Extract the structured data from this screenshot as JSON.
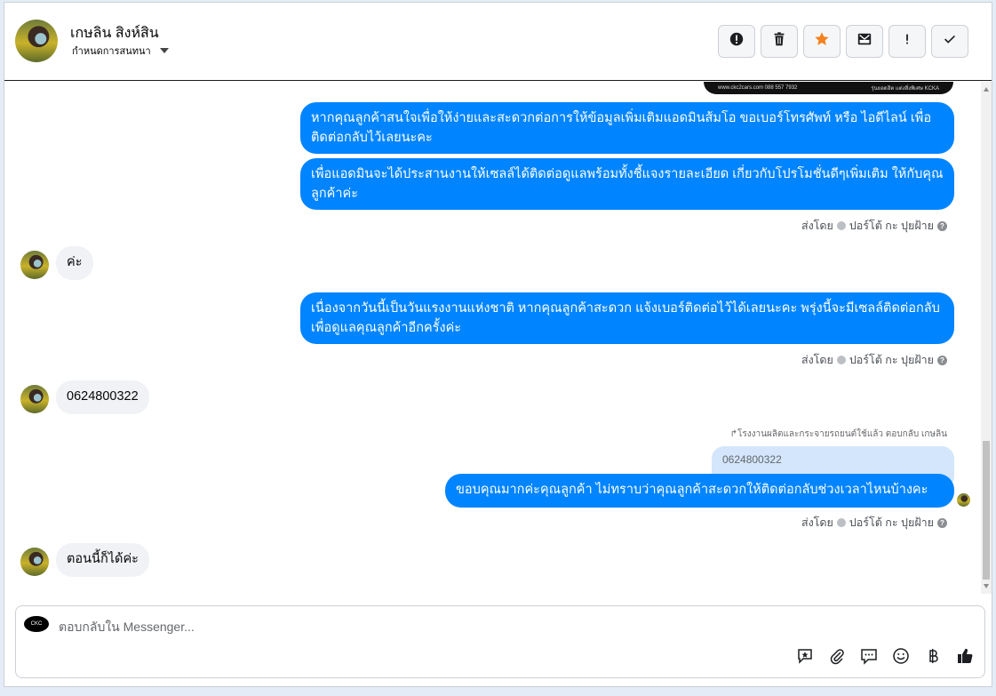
{
  "header": {
    "contact_name": "เกษลิน สิงห์สิน",
    "assign_label": "กำหนดการสนทนา",
    "colors": {
      "star": "#f5821f",
      "icon": "#1c1e21"
    }
  },
  "toolbar": {
    "icons": [
      "alert-circle-icon",
      "trash-icon",
      "star-icon",
      "mark-unread-icon",
      "exclamation-icon",
      "check-icon"
    ]
  },
  "banner": {
    "left_text": "www.ckc2cars.com  088 557 7932",
    "right_text": "รุ่นยอดฮิต แต่งสิ่งพิเศษ  KCKA"
  },
  "messages": {
    "m1": "หากคุณลูกค้าสนใจเพื่อให้ง่ายและสะดวกต่อการให้ข้อมูลเพิ่มเติมแอดมินส้มโอ ขอเบอร์โทรศัพท์ หรือ ไอดีไลน์ เพื่อติดต่อกลับไว้เลยนะคะ",
    "m2": "เพื่อแอดมินจะได้ประสานงานให้เซลล์ได้ติดต่อดูแลพร้อมทั้งชี้แจงรายละเอียด เกี่ยวกับโปรโมชั่นดีๆเพิ่มเติม ให้กับคุณลูกค้าค่ะ",
    "m3": "ค่ะ",
    "m4": "เนื่องจากวันนี้เป็นวันแรงงานแห่งชาติ หากคุณลูกค้าสะดวก แจ้งเบอร์ติดต่อไว้ได้เลยนะคะ พรุ่งนี้จะมีเซลล์ติดต่อกลับเพื่อดูแลคุณลูกค้าอีกครั้งค่ะ",
    "m5": "0624800322",
    "reply_meta": "↱โรงงานผลิตและกระจายรถยนต์ใช้แล้ว ตอบกลับ เกษลิน",
    "quoted": "0624800322",
    "m6": "ขอบคุณมากค่ะคุณลูกค้า ไม่ทราบว่าคุณลูกค้าสะดวกให้ติดต่อกลับช่วงเวลาไหนบ้างคะ",
    "m7": "ตอนนี้ก็ได้ค่ะ"
  },
  "sent_by": {
    "prefix": "ส่งโดย",
    "name": "ปอร์โต้ กะ ปุยฝ้าย"
  },
  "composer": {
    "placeholder": "ตอบกลับใน Messenger...",
    "page_avatar_text": "CKC",
    "icons": [
      "saved-reply-icon",
      "attach-icon",
      "message-icon",
      "emoji-icon",
      "baht-icon",
      "like-icon"
    ]
  },
  "colors": {
    "outgoing": "#0084ff",
    "incoming": "#f0f2f5",
    "quoted": "#d3e6fb"
  }
}
